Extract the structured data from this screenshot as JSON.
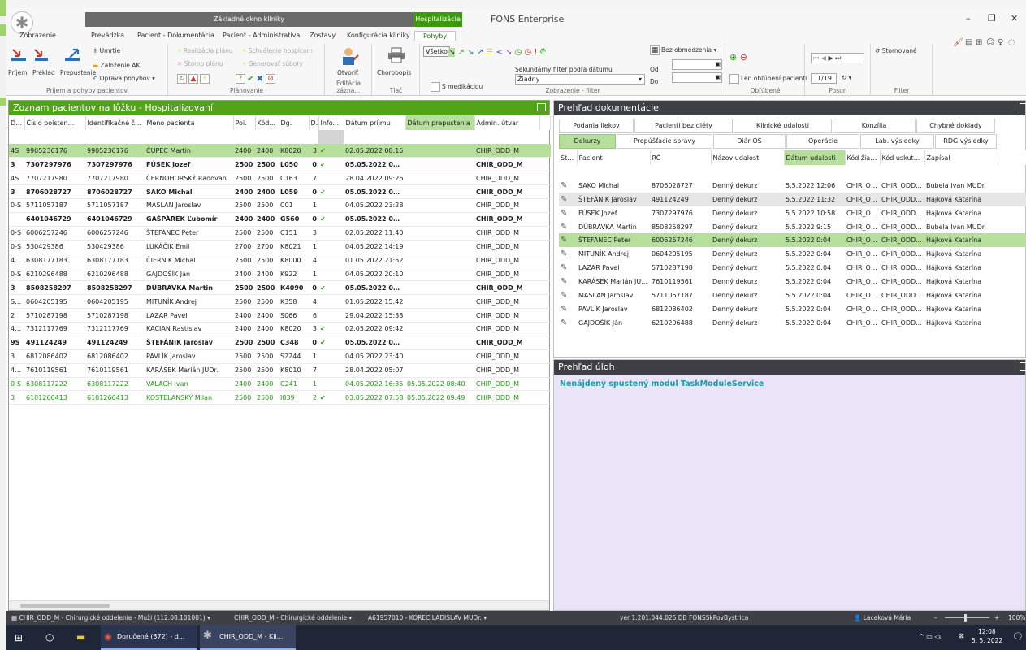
{
  "window": {
    "title": "FONS Enterprise",
    "ctx_gray": "Základné okno kliniky",
    "ctx_green": "Hospitalizácie"
  },
  "tabs": [
    "Zobrazenie",
    "Prevádzka",
    "Pacient - Dokumentácia",
    "Pacient - Administratíva",
    "Zostavy",
    "Konfigurácia kliniky",
    "Pohyby"
  ],
  "ribbon": {
    "g1": {
      "label": "Príjem a pohyby pacientov",
      "prijem": "Príjem",
      "preklad": "Preklad",
      "prepustenie": "Prepustenie",
      "umrtie": "Úmrtie",
      "zalozenie": "Založenie AK",
      "oprava": "Oprava pohybov"
    },
    "g2": {
      "label": "Plánovanie",
      "realizacia": "Realizácia plánu",
      "storno": "Storno plánu",
      "schvalenie": "Schválenie hospicom",
      "generovat": "Generovať súbory"
    },
    "g3": {
      "label": "Editácia zázna...",
      "otvorit": "Otvoriť"
    },
    "g4": {
      "label": "Tlač",
      "chorobopis": "Chorobopis"
    },
    "g5": {
      "label": "Zobrazenie - filter",
      "vsetko": "Všetko",
      "s_medikaciou": "S medikáciou",
      "sek_filter_label": "Sekundárny filter podľa dátumu",
      "sek_filter_value": "Žiadny",
      "bez_obmedzenia": "Bez obmedzenia",
      "od": "Od",
      "do": "Do"
    },
    "g6": {
      "label": "Obľúbené",
      "len_oblubeni": "Len obľúbení pacienti"
    },
    "g7": {
      "label": "Posun",
      "page": "1/19"
    },
    "g8": {
      "label": "Filter",
      "stornovane": "Stornované"
    }
  },
  "patients": {
    "title": "Zoznam pacientov na lôžku - Hospitalizovaní",
    "columns": [
      "Diéta",
      "Číslo poisten...",
      "Identifikačné čí...",
      "Meno pacienta",
      "Poi.",
      "Kód...",
      "Dg.",
      "D..",
      "Info...",
      "Dátum príjmu",
      "Dátum prepustenia",
      "Admin. útvar"
    ],
    "rows": [
      {
        "dieta": "4S",
        "cislo": "9905236176",
        "id": "9905236176",
        "meno": "ČUPEC Martin",
        "poi": "2400",
        "kod": "2400",
        "dg": "K8020",
        "d": "3",
        "info": "✔",
        "prijem": "02.05.2022 08:15",
        "prepust": "",
        "utvar": "CHIR_ODD_M"
      },
      {
        "dieta": "3",
        "cislo": "7307297976",
        "id": "7307297976",
        "meno": "FÚSEK Jozef",
        "poi": "2500",
        "kod": "2500",
        "dg": "L050",
        "d": "0",
        "info": "✔",
        "prijem": "05.05.2022 07:50",
        "prepust": "",
        "utvar": "CHIR_ODD_M"
      },
      {
        "dieta": "4S",
        "cislo": "7707217980",
        "id": "7707217980",
        "meno": "ČERNOHORSKÝ Radovan",
        "poi": "2500",
        "kod": "2500",
        "dg": "C163",
        "d": "7",
        "info": "",
        "prijem": "28.04.2022 09:26",
        "prepust": "",
        "utvar": "CHIR_ODD_M"
      },
      {
        "dieta": "3",
        "cislo": "8706028727",
        "id": "8706028727",
        "meno": "SAKO Michal",
        "poi": "2400",
        "kod": "2400",
        "dg": "L059",
        "d": "0",
        "info": "✔",
        "prijem": "05.05.2022 09:33",
        "prepust": "",
        "utvar": "CHIR_ODD_M"
      },
      {
        "dieta": "0-S",
        "cislo": "5711057187",
        "id": "5711057187",
        "meno": "MASLAN Jaroslav",
        "poi": "2500",
        "kod": "2500",
        "dg": "C01",
        "d": "1",
        "info": "",
        "prijem": "04.05.2022 23:28",
        "prepust": "",
        "utvar": "CHIR_ODD_M"
      },
      {
        "dieta": "",
        "cislo": "6401046729",
        "id": "6401046729",
        "meno": "GAŠPÁREK Ľubomír",
        "poi": "2400",
        "kod": "2400",
        "dg": "G560",
        "d": "0",
        "info": "✔",
        "prijem": "05.05.2022 08:27",
        "prepust": "",
        "utvar": "CHIR_ODD_M"
      },
      {
        "dieta": "0-S",
        "cislo": "6006257246",
        "id": "6006257246",
        "meno": "ŠTEFANEC Peter",
        "poi": "2500",
        "kod": "2500",
        "dg": "C151",
        "d": "3",
        "info": "",
        "prijem": "02.05.2022 11:40",
        "prepust": "",
        "utvar": "CHIR_ODD_M"
      },
      {
        "dieta": "0-S",
        "cislo": "530429386",
        "id": "530429386",
        "meno": "LUKÁČIK Emil",
        "poi": "2700",
        "kod": "2700",
        "dg": "K8021",
        "d": "1",
        "info": "",
        "prijem": "04.05.2022 14:19",
        "prepust": "",
        "utvar": "CHIR_ODD_M"
      },
      {
        "dieta": "4ST/9",
        "cislo": "6308177183",
        "id": "6308177183",
        "meno": "ČIERNIK Michal",
        "poi": "2500",
        "kod": "2500",
        "dg": "K8000",
        "d": "4",
        "info": "",
        "prijem": "01.05.2022 21:52",
        "prepust": "",
        "utvar": "CHIR_ODD_M"
      },
      {
        "dieta": "0-S",
        "cislo": "6210296488",
        "id": "6210296488",
        "meno": "GAJDOŠÍK Ján",
        "poi": "2400",
        "kod": "2400",
        "dg": "K922",
        "d": "1",
        "info": "",
        "prijem": "04.05.2022 20:10",
        "prepust": "",
        "utvar": "CHIR_ODD_M"
      },
      {
        "dieta": "3",
        "cislo": "8508258297",
        "id": "8508258297",
        "meno": "DÚBRAVKA Martin",
        "poi": "2500",
        "kod": "2500",
        "dg": "K4090",
        "d": "0",
        "info": "✔",
        "prijem": "05.05.2022 08:31",
        "prepust": "",
        "utvar": "CHIR_ODD_M"
      },
      {
        "dieta": "S/BLK",
        "cislo": "0604205195",
        "id": "0604205195",
        "meno": "MITUNÍK Andrej",
        "poi": "2500",
        "kod": "2500",
        "dg": "K358",
        "d": "4",
        "info": "",
        "prijem": "01.05.2022 15:42",
        "prepust": "",
        "utvar": "CHIR_ODD_M"
      },
      {
        "dieta": "2",
        "cislo": "5710287198",
        "id": "5710287198",
        "meno": "LAZAR Pavel",
        "poi": "2400",
        "kod": "2400",
        "dg": "S066",
        "d": "6",
        "info": "",
        "prijem": "29.04.2022 15:33",
        "prepust": "",
        "utvar": "CHIR_ODD_M"
      },
      {
        "dieta": "4ST/9",
        "cislo": "7312117769",
        "id": "7312117769",
        "meno": "KACIAN Rastislav",
        "poi": "2400",
        "kod": "2400",
        "dg": "K8020",
        "d": "3",
        "info": "✔",
        "prijem": "02.05.2022 09:42",
        "prepust": "",
        "utvar": "CHIR_ODD_M"
      },
      {
        "dieta": "9S",
        "cislo": "491124249",
        "id": "491124249",
        "meno": "ŠTEFÁNIK Jaroslav",
        "poi": "2500",
        "kod": "2500",
        "dg": "C348",
        "d": "0",
        "info": "✔",
        "prijem": "05.05.2022 09:45",
        "prepust": "",
        "utvar": "CHIR_ODD_M"
      },
      {
        "dieta": "3",
        "cislo": "6812086402",
        "id": "6812086402",
        "meno": "PAVLÍK Jaroslav",
        "poi": "2500",
        "kod": "2500",
        "dg": "S2244",
        "d": "1",
        "info": "",
        "prijem": "04.05.2022 23:40",
        "prepust": "",
        "utvar": "CHIR_ODD_M"
      },
      {
        "dieta": "4ST/9",
        "cislo": "7610119561",
        "id": "7610119561",
        "meno": "KARÁSEK Marián JUDr.",
        "poi": "2500",
        "kod": "2500",
        "dg": "K8010",
        "d": "7",
        "info": "",
        "prijem": "28.04.2022 05:07",
        "prepust": "",
        "utvar": "CHIR_ODD_M"
      },
      {
        "dieta": "0-S",
        "cislo": "6308117222",
        "id": "6308117222",
        "meno": "VALACH Ivan",
        "poi": "2400",
        "kod": "2400",
        "dg": "C241",
        "d": "1",
        "info": "",
        "prijem": "04.05.2022 16:35",
        "prepust": "05.05.2022 08:40",
        "utvar": "CHIR_ODD_M"
      },
      {
        "dieta": "3",
        "cislo": "6101266413",
        "id": "6101266413",
        "meno": "KOSTELANSKÝ Milan",
        "poi": "2500",
        "kod": "2500",
        "dg": "I839",
        "d": "2",
        "info": "✔",
        "prijem": "03.05.2022 07:58",
        "prepust": "05.05.2022 09:49",
        "utvar": "CHIR_ODD_M"
      }
    ]
  },
  "documents": {
    "title": "Prehľad dokumentácie",
    "tabs_row1": [
      "Podania liekov",
      "Pacienti bez diéty",
      "Klinické udalosti",
      "Konzília",
      "Chybné doklady"
    ],
    "tabs_row2": [
      "Dekurzy",
      "Prepúšťacie správy",
      "Diár OS",
      "Operácie",
      "Lab. výsledky",
      "RDG výsledky"
    ],
    "columns": [
      "Stav",
      "Pacient",
      "RČ",
      "Názov udalosti",
      "Dátum udalosti",
      "Kód žiada...",
      "Kód uskut...",
      "Zapísal"
    ],
    "rows": [
      {
        "pacient": "SAKO Michal",
        "rc": "8706028727",
        "nazov": "Denný dekurz",
        "datum": "5.5.2022 12:06",
        "kz": "CHIR_ODD...",
        "ku": "CHIR_ODD...",
        "zapisal": "Bubela Ivan MUDr."
      },
      {
        "pacient": "ŠTEFÁNIK Jaroslav",
        "rc": "491124249",
        "nazov": "Denný dekurz",
        "datum": "5.5.2022 11:32",
        "kz": "CHIR_ODD...",
        "ku": "CHIR_ODD...",
        "zapisal": "Hájková Katarína"
      },
      {
        "pacient": "FÚSEK Jozef",
        "rc": "7307297976",
        "nazov": "Denný dekurz",
        "datum": "5.5.2022 10:58",
        "kz": "CHIR_ODD...",
        "ku": "CHIR_ODD...",
        "zapisal": "Hájková Katarína"
      },
      {
        "pacient": "DÚBRAVKA Martin",
        "rc": "8508258297",
        "nazov": "Denný dekurz",
        "datum": "5.5.2022 9:15",
        "kz": "CHIR_ODD...",
        "ku": "CHIR_ODD...",
        "zapisal": "Bubela Ivan MUDr."
      },
      {
        "pacient": "ŠTEFANEC Peter",
        "rc": "6006257246",
        "nazov": "Denný dekurz",
        "datum": "5.5.2022 0:04",
        "kz": "CHIR_ODD...",
        "ku": "CHIR_ODD...",
        "zapisal": "Hájková Katarína"
      },
      {
        "pacient": "MITUNÍK Andrej",
        "rc": "0604205195",
        "nazov": "Denný dekurz",
        "datum": "5.5.2022 0:04",
        "kz": "CHIR_ODD...",
        "ku": "CHIR_ODD...",
        "zapisal": "Hájková Katarína"
      },
      {
        "pacient": "LAZAR Pavel",
        "rc": "5710287198",
        "nazov": "Denný dekurz",
        "datum": "5.5.2022 0:04",
        "kz": "CHIR_ODD...",
        "ku": "CHIR_ODD...",
        "zapisal": "Hájková Katarína"
      },
      {
        "pacient": "KARÁSEK Marián JU...",
        "rc": "7610119561",
        "nazov": "Denný dekurz",
        "datum": "5.5.2022 0:04",
        "kz": "CHIR_ODD...",
        "ku": "CHIR_ODD...",
        "zapisal": "Hájková Katarína"
      },
      {
        "pacient": "MASLAN Jaroslav",
        "rc": "5711057187",
        "nazov": "Denný dekurz",
        "datum": "5.5.2022 0:04",
        "kz": "CHIR_ODD...",
        "ku": "CHIR_ODD...",
        "zapisal": "Hájková Katarína"
      },
      {
        "pacient": "PAVLÍK Jaroslav",
        "rc": "6812086402",
        "nazov": "Denný dekurz",
        "datum": "5.5.2022 0:04",
        "kz": "CHIR_ODD...",
        "ku": "CHIR_ODD...",
        "zapisal": "Hájková Katarína"
      },
      {
        "pacient": "GAJDOŠÍK Ján",
        "rc": "6210296488",
        "nazov": "Denný dekurz",
        "datum": "5.5.2022 0:04",
        "kz": "CHIR_ODD...",
        "ku": "CHIR_ODD...",
        "zapisal": "Hájková Katarína"
      }
    ]
  },
  "tasks": {
    "title": "Prehľad úloh",
    "message": "Nenájdený spustený modul TaskModuleService"
  },
  "statusbar": {
    "s1": "CHIR_ODD_M - Chirurgické oddelenie - Muži (112.08.101001)",
    "s2": "CHIR_ODD_M - Chirurgické oddelenie",
    "s3": "A61957010 - KOREC LADISLAV MUDr.",
    "version": "ver 1.201.044.025 DB FONSSkPovBystrica",
    "user": "Laceková Mária",
    "zoom": "100%"
  },
  "taskbar": {
    "app1": "Doručené (372) - d...",
    "app2": "CHIR_ODD_M - Kli...",
    "time": "12:08",
    "date": "5. 5. 2022"
  },
  "colors": {
    "green_header": "#53a318",
    "dark_header": "#3f3f46",
    "selected_row": "#b5df9a",
    "discharged": "#1f9a12",
    "task_msg": "#1b9aa8"
  }
}
